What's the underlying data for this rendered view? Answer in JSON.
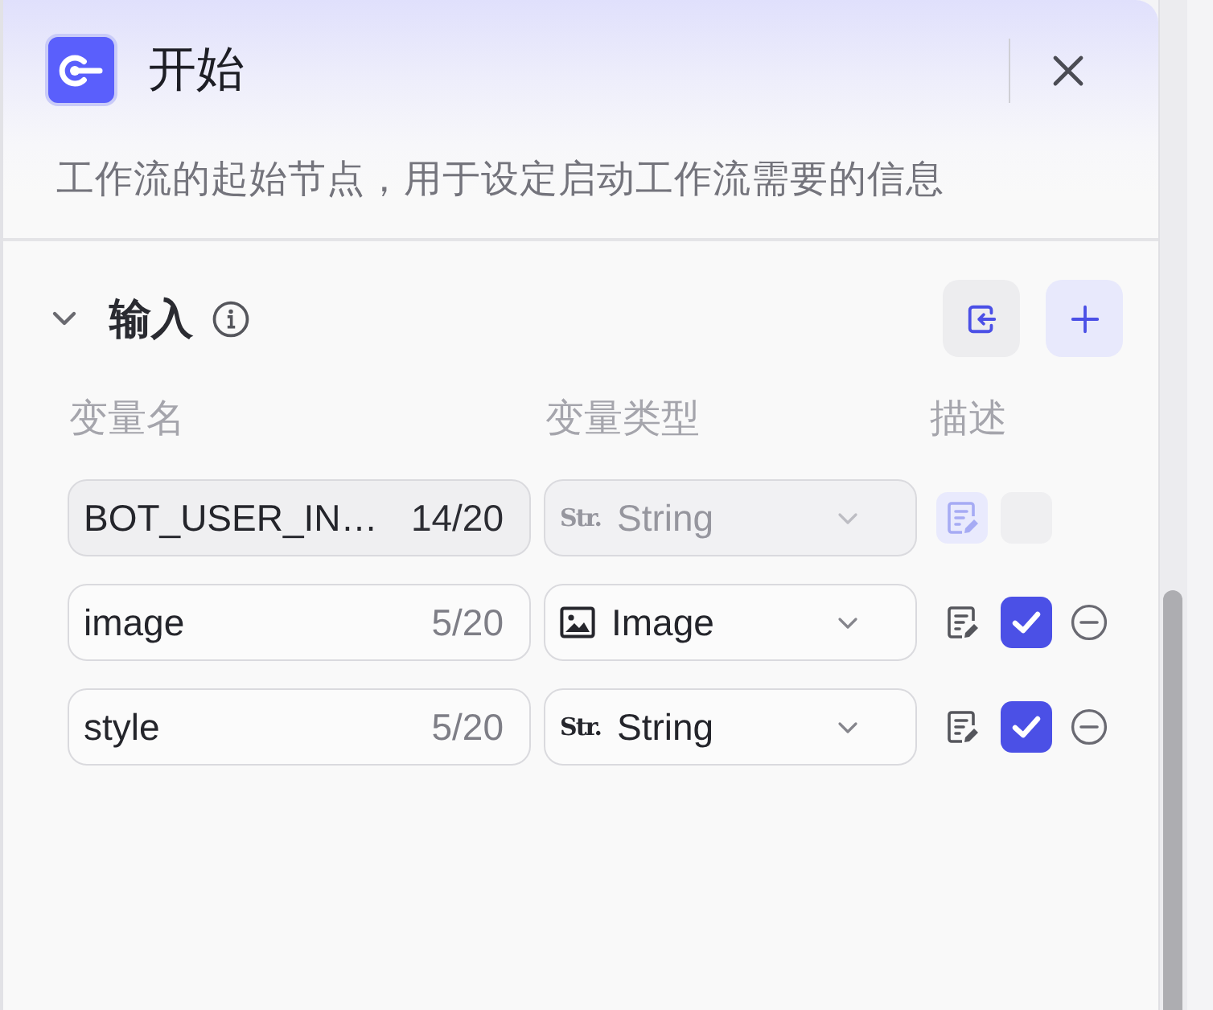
{
  "header": {
    "title": "开始",
    "description": "工作流的起始节点，用于设定启动工作流需要的信息"
  },
  "input_section": {
    "title": "输入",
    "expanded": true,
    "columns": [
      "变量名",
      "变量类型",
      "描述"
    ],
    "variables": [
      {
        "name": "BOT_USER_IN…",
        "count": "14/20",
        "type": {
          "kind": "string",
          "abbreviation": "Str.",
          "label": "String"
        },
        "disabled": true,
        "checked": false
      },
      {
        "name": "image",
        "count": "5/20",
        "type": {
          "kind": "image",
          "label": "Image"
        },
        "disabled": false,
        "checked": true
      },
      {
        "name": "style",
        "count": "5/20",
        "type": {
          "kind": "string",
          "abbreviation": "Str.",
          "label": "String"
        },
        "disabled": false,
        "checked": true
      }
    ]
  }
}
